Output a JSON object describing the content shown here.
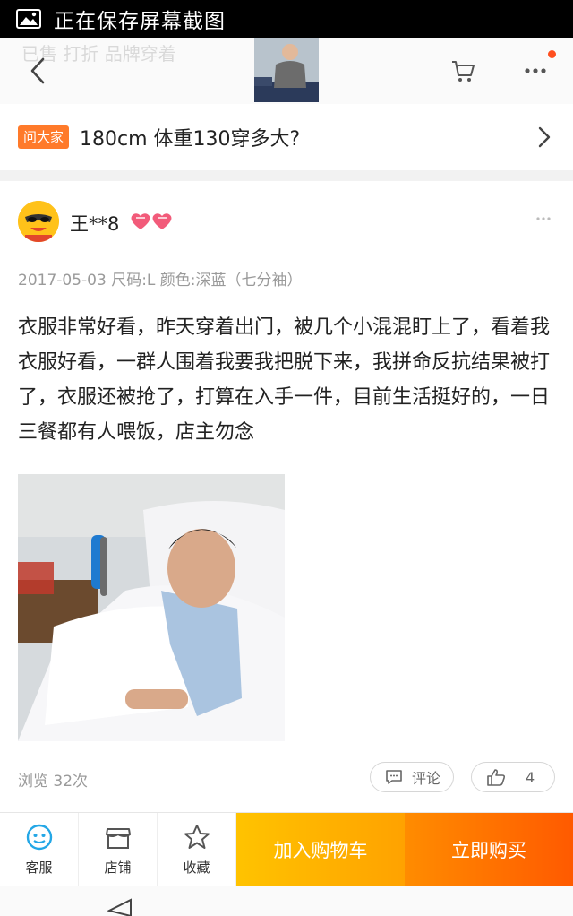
{
  "status_bar": {
    "text": "正在保存屏幕截图",
    "icon": "gallery-icon"
  },
  "nav": {
    "faded_title": "已售 打折 品牌穿着",
    "faded_sub": ""
  },
  "question": {
    "badge": "问大家",
    "text": "180cm  体重130穿多大?"
  },
  "review": {
    "username": "王**8",
    "meta": "2017-05-03 尺码:L 颜色:深蓝（七分袖）",
    "text": "衣服非常好看，昨天穿着出门，被几个小混混盯上了，看着我衣服好看，一群人围着我要我把脱下来，我拼命反抗结果被打了，衣服还被抢了，打算在入手一件，目前生活挺好的，一日三餐都有人喂饭，店主勿念",
    "views": "浏览 32次",
    "comment_label": "评论",
    "like_count": "4"
  },
  "bottom_bar": {
    "tabs": [
      {
        "label": "客服",
        "icon": "customer-service-icon"
      },
      {
        "label": "店铺",
        "icon": "store-icon"
      },
      {
        "label": "收藏",
        "icon": "star-icon"
      }
    ],
    "add_to_cart": "加入购物车",
    "buy_now": "立即购买"
  },
  "colors": {
    "accent_orange": "#ff5a00",
    "accent_yellow": "#ffb400",
    "badge": "#ff7a2a"
  }
}
